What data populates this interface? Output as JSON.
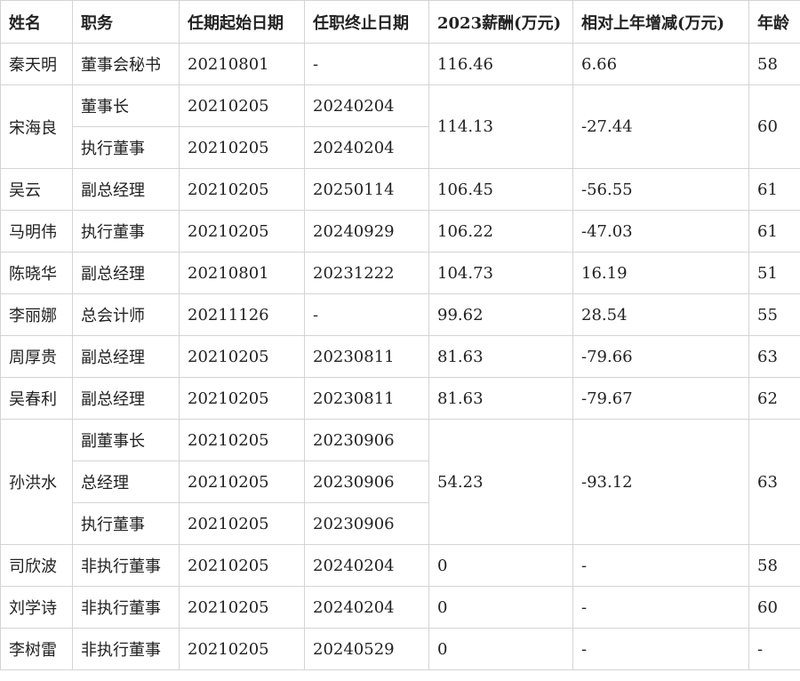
{
  "headers": [
    "姓名",
    "职务",
    "任期起始日期",
    "任职终止日期",
    "2023薪酬(万元)",
    "相对上年增减(万元)",
    "年龄"
  ],
  "rows": [
    {
      "name": "秦天明",
      "roles": [
        {
          "title": "董事会秘书",
          "start": "20210801",
          "end": "-"
        }
      ],
      "pay": "116.46",
      "change": "6.66",
      "age": "58"
    },
    {
      "name": "宋海良",
      "roles": [
        {
          "title": "董事长",
          "start": "20210205",
          "end": "20240204"
        },
        {
          "title": "执行董事",
          "start": "20210205",
          "end": "20240204"
        }
      ],
      "pay": "114.13",
      "change": "-27.44",
      "age": "60"
    },
    {
      "name": "吴云",
      "roles": [
        {
          "title": "副总经理",
          "start": "20210205",
          "end": "20250114"
        }
      ],
      "pay": "106.45",
      "change": "-56.55",
      "age": "61"
    },
    {
      "name": "马明伟",
      "roles": [
        {
          "title": "执行董事",
          "start": "20210205",
          "end": "20240929"
        }
      ],
      "pay": "106.22",
      "change": "-47.03",
      "age": "61"
    },
    {
      "name": "陈晓华",
      "roles": [
        {
          "title": "副总经理",
          "start": "20210801",
          "end": "20231222"
        }
      ],
      "pay": "104.73",
      "change": "16.19",
      "age": "51"
    },
    {
      "name": "李丽娜",
      "roles": [
        {
          "title": "总会计师",
          "start": "20211126",
          "end": "-"
        }
      ],
      "pay": "99.62",
      "change": "28.54",
      "age": "55"
    },
    {
      "name": "周厚贵",
      "roles": [
        {
          "title": "副总经理",
          "start": "20210205",
          "end": "20230811"
        }
      ],
      "pay": "81.63",
      "change": "-79.66",
      "age": "63"
    },
    {
      "name": "吴春利",
      "roles": [
        {
          "title": "副总经理",
          "start": "20210205",
          "end": "20230811"
        }
      ],
      "pay": "81.63",
      "change": "-79.67",
      "age": "62"
    },
    {
      "name": "孙洪水",
      "roles": [
        {
          "title": "副董事长",
          "start": "20210205",
          "end": "20230906"
        },
        {
          "title": "总经理",
          "start": "20210205",
          "end": "20230906"
        },
        {
          "title": "执行董事",
          "start": "20210205",
          "end": "20230906"
        }
      ],
      "pay": "54.23",
      "change": "-93.12",
      "age": "63"
    },
    {
      "name": "司欣波",
      "roles": [
        {
          "title": "非执行董事",
          "start": "20210205",
          "end": "20240204"
        }
      ],
      "pay": "0",
      "change": "-",
      "age": "58"
    },
    {
      "name": "刘学诗",
      "roles": [
        {
          "title": "非执行董事",
          "start": "20210205",
          "end": "20240204"
        }
      ],
      "pay": "0",
      "change": "-",
      "age": "60"
    },
    {
      "name": "李树雷",
      "roles": [
        {
          "title": "非执行董事",
          "start": "20210205",
          "end": "20240529"
        }
      ],
      "pay": "0",
      "change": "-",
      "age": "-"
    }
  ]
}
